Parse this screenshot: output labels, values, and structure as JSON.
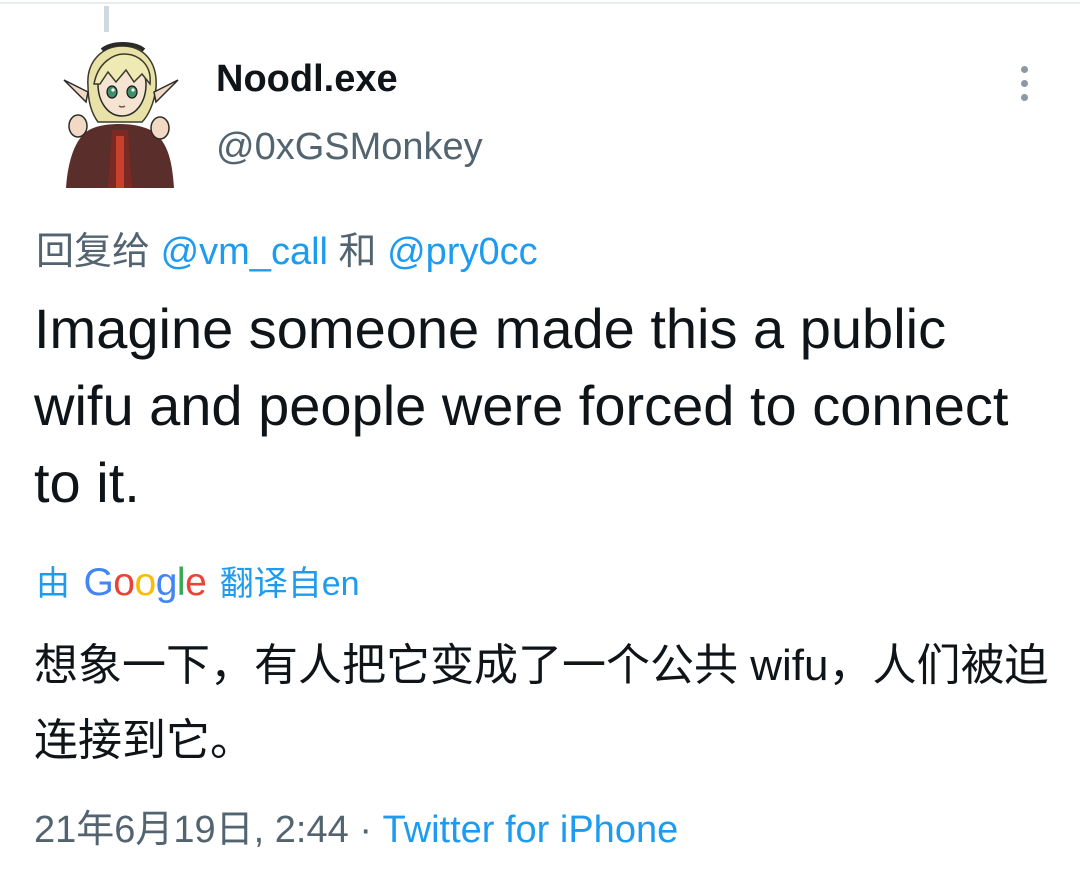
{
  "tweet": {
    "display_name": "Noodl.exe",
    "handle": "@0xGSMonkey",
    "avatar_icon": "anime-character-avatar",
    "more_icon": "more-vertical-icon",
    "reply_prefix": "回复给",
    "reply_mention_1": "@vm_call",
    "reply_conjunction": "和",
    "reply_mention_2": "@pry0cc",
    "text": "Imagine someone made this a public wifu and people were forced to connect to it.",
    "translate_prefix": "由",
    "translate_brand": {
      "g1": "G",
      "o1": "o",
      "o2": "o",
      "g2": "g",
      "l": "l",
      "e": "e"
    },
    "translate_suffix": "翻译自en",
    "translated_text": "想象一下，有人把它变成了一个公共 wifu，人们被迫连接到它。",
    "date_time": "21年6月19日, 2:44",
    "separator": "·",
    "source": "Twitter for iPhone"
  },
  "colors": {
    "link": "#1d9bf0",
    "secondary_text": "#536471",
    "primary_text": "#0f1419"
  }
}
